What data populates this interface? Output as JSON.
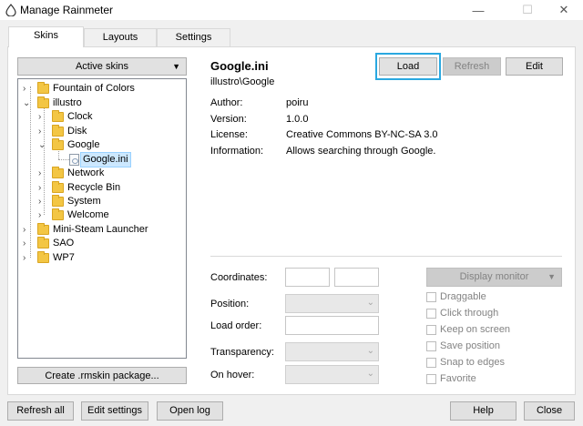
{
  "window": {
    "title": "Manage Rainmeter",
    "minimize": "—",
    "maximize": "☐",
    "close": "✕"
  },
  "tabs": [
    {
      "label": "Skins"
    },
    {
      "label": "Layouts"
    },
    {
      "label": "Settings"
    }
  ],
  "skins_panel": {
    "active_skins_label": "Active skins",
    "create_package_label": "Create .rmskin package...",
    "tree": [
      {
        "label": "Fountain of Colors",
        "type": "folder",
        "expanded": false
      },
      {
        "label": "illustro",
        "type": "folder",
        "expanded": true
      },
      {
        "label": "Clock",
        "type": "folder",
        "expanded": false
      },
      {
        "label": "Disk",
        "type": "folder",
        "expanded": false
      },
      {
        "label": "Google",
        "type": "folder",
        "expanded": true
      },
      {
        "label": "Google.ini",
        "type": "file",
        "selected": true
      },
      {
        "label": "Network",
        "type": "folder",
        "expanded": false
      },
      {
        "label": "Recycle Bin",
        "type": "folder",
        "expanded": false
      },
      {
        "label": "System",
        "type": "folder",
        "expanded": false
      },
      {
        "label": "Welcome",
        "type": "folder",
        "expanded": false
      },
      {
        "label": "Mini-Steam Launcher",
        "type": "folder",
        "expanded": false
      },
      {
        "label": "SAO",
        "type": "folder",
        "expanded": false
      },
      {
        "label": "WP7",
        "type": "folder",
        "expanded": false
      }
    ]
  },
  "details": {
    "file_name": "Google.ini",
    "path": "illustro\\Google",
    "load_label": "Load",
    "refresh_label": "Refresh",
    "edit_label": "Edit",
    "author_label": "Author:",
    "author": "poiru",
    "version_label": "Version:",
    "version": "1.0.0",
    "license_label": "License:",
    "license": "Creative Commons BY-NC-SA 3.0",
    "information_label": "Information:",
    "information": "Allows searching through Google."
  },
  "settings": {
    "coordinates_label": "Coordinates:",
    "position_label": "Position:",
    "load_order_label": "Load order:",
    "transparency_label": "Transparency:",
    "on_hover_label": "On hover:",
    "display_monitor_label": "Display monitor",
    "checkboxes": [
      {
        "label": "Draggable"
      },
      {
        "label": "Click through"
      },
      {
        "label": "Keep on screen"
      },
      {
        "label": "Save position"
      },
      {
        "label": "Snap to edges"
      },
      {
        "label": "Favorite"
      }
    ]
  },
  "footer": {
    "refresh_all_label": "Refresh all",
    "edit_settings_label": "Edit settings",
    "open_log_label": "Open log",
    "help_label": "Help",
    "close_label": "Close"
  },
  "colors": {
    "focus_outline": "#2aa8e0",
    "selection": "#cce8ff",
    "folder": "#f3c644"
  }
}
